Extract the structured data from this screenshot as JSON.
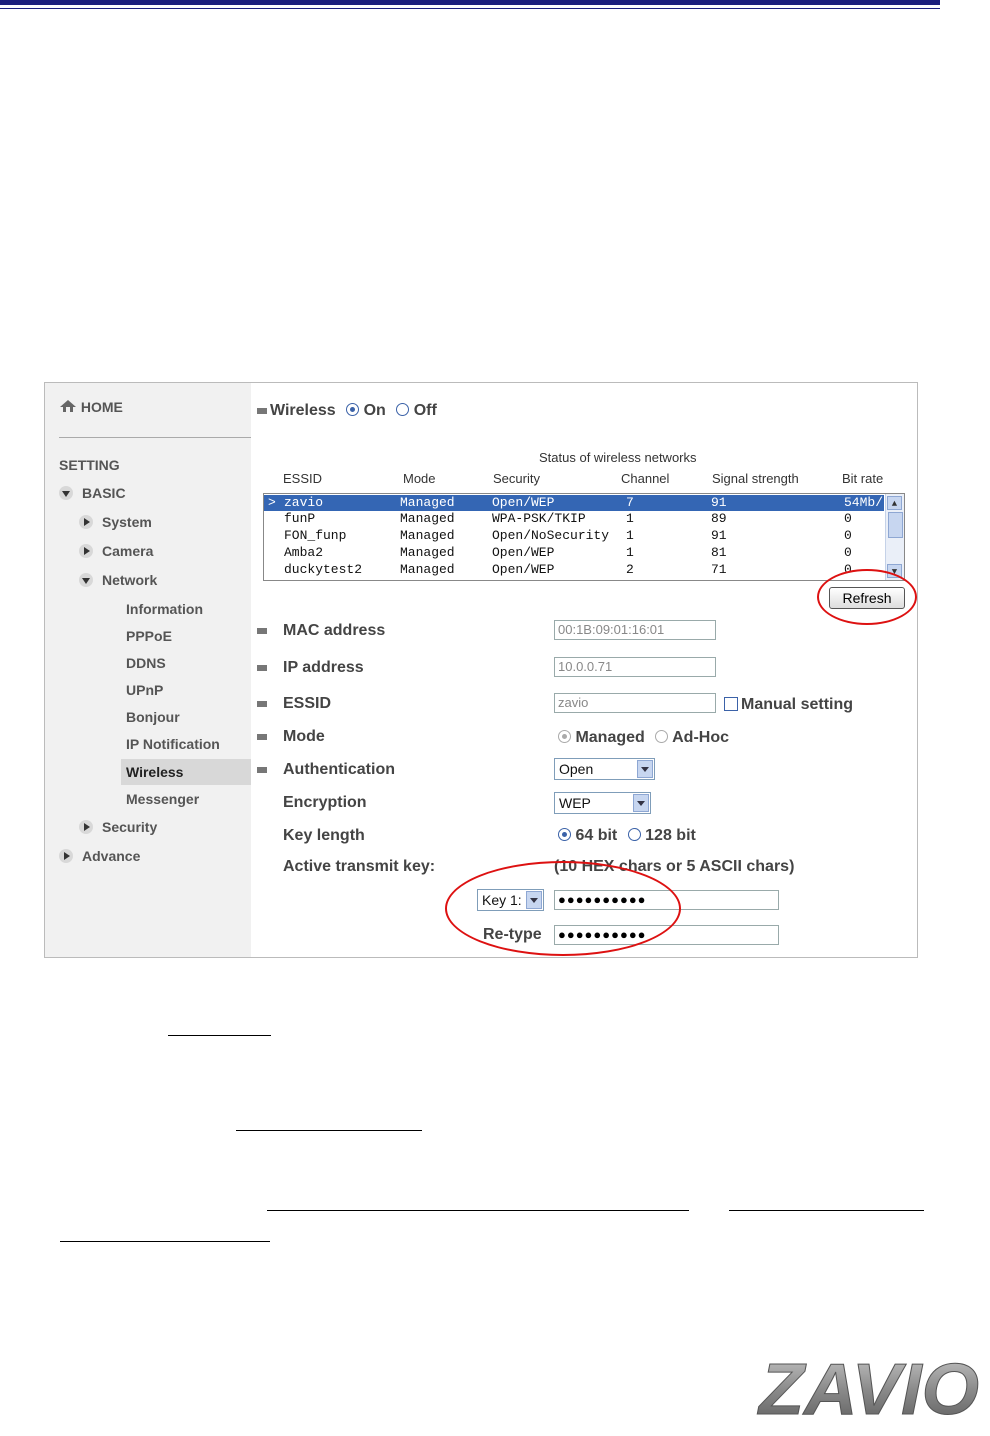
{
  "sidebar": {
    "home": "HOME",
    "setting": "SETTING",
    "basic": "BASIC",
    "system": "System",
    "camera": "Camera",
    "network": "Network",
    "information": "Information",
    "pppoe": "PPPoE",
    "ddns": "DDNS",
    "upnp": "UPnP",
    "bonjour": "Bonjour",
    "ip_notification": "IP Notification",
    "wireless": "Wireless",
    "messenger": "Messenger",
    "security": "Security",
    "advance": "Advance"
  },
  "wireless": {
    "label": "Wireless",
    "on_label": "On",
    "off_label": "Off",
    "state": "On"
  },
  "networks": {
    "title": "Status of wireless networks",
    "headers": {
      "essid": "ESSID",
      "mode": "Mode",
      "security": "Security",
      "channel": "Channel",
      "signal": "Signal strength",
      "bitrate": "Bit rate"
    },
    "rows": [
      {
        "marker": ">",
        "essid": "zavio",
        "mode": "Managed",
        "security": "Open/WEP",
        "channel": "7",
        "signal": "91",
        "bitrate": "54Mb/"
      },
      {
        "marker": "",
        "essid": "funP",
        "mode": "Managed",
        "security": "WPA-PSK/TKIP",
        "channel": "1",
        "signal": "89",
        "bitrate": "0"
      },
      {
        "marker": "",
        "essid": "FON_funp",
        "mode": "Managed",
        "security": "Open/NoSecurity",
        "channel": "1",
        "signal": "91",
        "bitrate": "0"
      },
      {
        "marker": "",
        "essid": "Amba2",
        "mode": "Managed",
        "security": "Open/WEP",
        "channel": "1",
        "signal": "81",
        "bitrate": "0"
      },
      {
        "marker": "",
        "essid": "duckytest2",
        "mode": "Managed",
        "security": "Open/WEP",
        "channel": "2",
        "signal": "71",
        "bitrate": "0"
      }
    ],
    "refresh_label": "Refresh"
  },
  "form": {
    "mac_label": "MAC address",
    "mac_value": "00:1B:09:01:16:01",
    "ip_label": "IP address",
    "ip_value": "10.0.0.71",
    "essid_label": "ESSID",
    "essid_value": "zavio",
    "manual_label": "Manual setting",
    "mode_label": "Mode",
    "mode_managed": "Managed",
    "mode_adhoc": "Ad-Hoc",
    "auth_label": "Authentication",
    "auth_value": "Open",
    "enc_label": "Encryption",
    "enc_value": "WEP",
    "keylen_label": "Key length",
    "keylen_64": "64 bit",
    "keylen_128": "128 bit",
    "active_key_label": "Active transmit key:",
    "key_hint": "(10 HEX chars or 5 ASCII chars)",
    "key_select": "Key 1:",
    "key_value": "●●●●●●●●●●",
    "retype_label": "Re-type",
    "retype_value": "●●●●●●●●●●"
  },
  "colors": {
    "highlight": "#3466b4",
    "annotation": "#dd1111",
    "topbar": "#1c1f7c"
  },
  "logo": {
    "text": "ZAVIO"
  }
}
